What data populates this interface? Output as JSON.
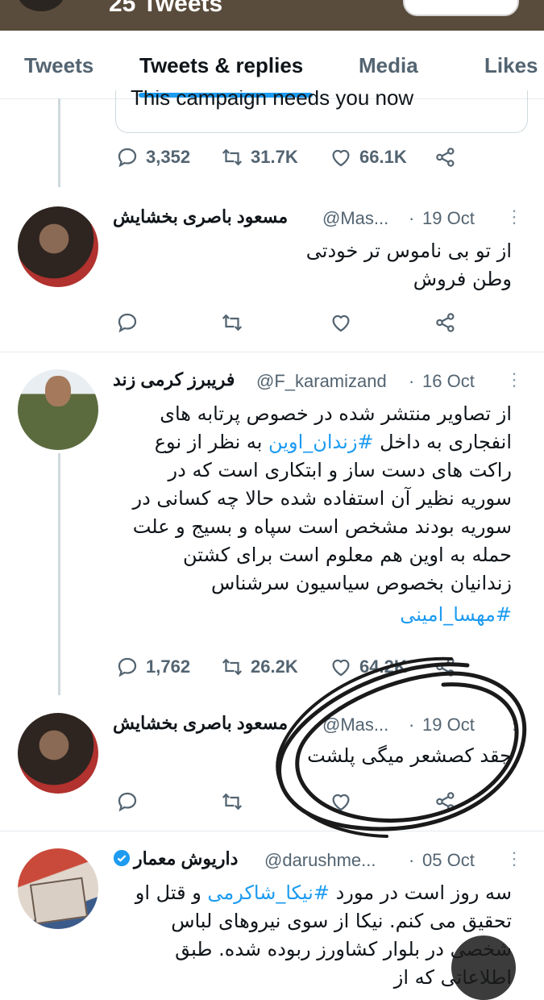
{
  "profile": {
    "tweet_count": "25 Tweets"
  },
  "tabs": [
    {
      "label": "Tweets"
    },
    {
      "label": "Tweets & replies"
    },
    {
      "label": "Media"
    },
    {
      "label": "Likes"
    }
  ],
  "quoted_card": {
    "text": "This campaign needs you now"
  },
  "top_actions": {
    "replies": "3,352",
    "retweets": "31.7K",
    "likes": "66.1K"
  },
  "tweets": [
    {
      "name": "مسعود باصری بخشایش",
      "handle": "@Mas...",
      "date": "19 Oct",
      "lines": [
        "از تو بی ناموس تر خودتی",
        "وطن فروش"
      ]
    },
    {
      "name": "فریبرز کرمی زند",
      "handle": "@F_karamizand",
      "date": "16 Oct",
      "text_parts": {
        "p1": "از تصاویر منتشر شده در خصوص پرتابه های انفجاری به داخل ",
        "hashtag1": "#زندان_اوین",
        "p2": " به نظر از نوع راکت های دست ساز و ابتکاری است که در سوریه نظیر آن استفاده شده حالا چه کسانی در سوریه بودند مشخص است سپاه و بسیج و علت حمله به اوین هم معلوم است برای کشتن زندانیان بخصوص سیاسیون سرشناس",
        "hashtag2": "#مهسا_امینی"
      },
      "actions": {
        "replies": "1,762",
        "retweets": "26.2K",
        "likes": "64.2K"
      }
    },
    {
      "name": "مسعود باصری بخشایش",
      "handle": "@Mas...",
      "date": "19 Oct",
      "lines": [
        "چقد کصشعر میگی پلشت"
      ]
    },
    {
      "name": "داریوش معمار",
      "handle": "@darushme...",
      "date": "05 Oct",
      "text_parts": {
        "p1": "سه روز است در مورد ",
        "hashtag1": "#نیکا_شاکرمی",
        "p2": " و قتل او تحقیق می کنم. نیکا از سوی نیروهای لباس شخصی در بلوار کشاورز ربوده شده. طبق اطلاعاتی که از"
      }
    }
  ]
}
